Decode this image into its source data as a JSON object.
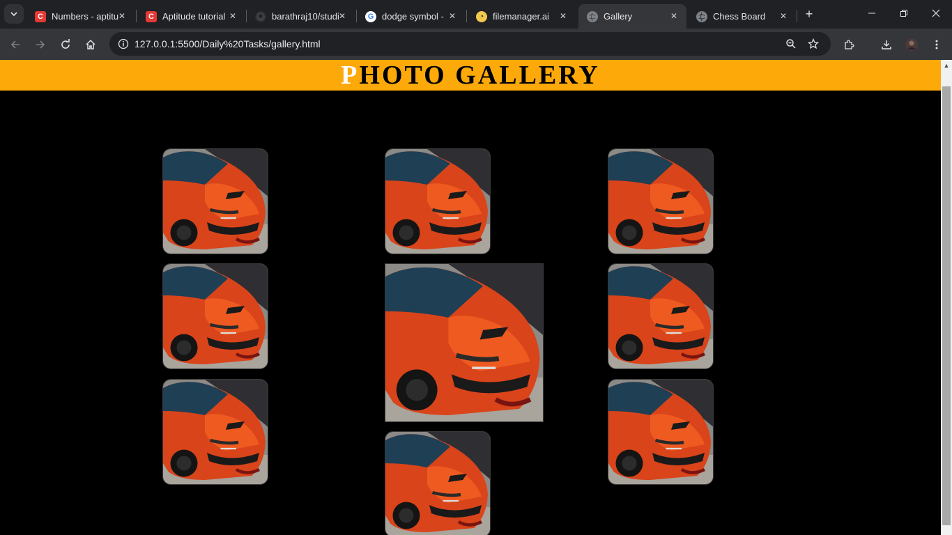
{
  "browser": {
    "tabs": [
      {
        "title": "Numbers - aptitude",
        "favicon": "c-logo-icon",
        "color": "#e53935"
      },
      {
        "title": "Aptitude tutorial",
        "favicon": "c-logo-icon",
        "color": "#e53935"
      },
      {
        "title": "barathraj10/studi",
        "favicon": "github-icon",
        "color": "#24292f"
      },
      {
        "title": "dodge symbol -",
        "favicon": "google-icon",
        "color": "#ffffff"
      },
      {
        "title": "filemanager.ai",
        "favicon": "filemanager-icon",
        "color": "#f2c94c"
      },
      {
        "title": "Gallery",
        "favicon": "globe-icon",
        "color": "#9aa0a6"
      },
      {
        "title": "Chess Board",
        "favicon": "globe-icon",
        "color": "#9aa0a6"
      }
    ],
    "active_tab_index": 5,
    "url": "127.0.0.1:5500/Daily%20Tasks/gallery.html"
  },
  "page": {
    "header_first_letter": "P",
    "header_rest": "HOTO GALLERY",
    "header_color": "#fea90a",
    "photo_alt": "Orange Dodge Charger",
    "photos": [
      {
        "name": "gallery-photo-1",
        "big": false
      },
      {
        "name": "gallery-photo-2",
        "big": false
      },
      {
        "name": "gallery-photo-3",
        "big": false
      },
      {
        "name": "gallery-photo-4",
        "big": false
      },
      {
        "name": "gallery-photo-5-enlarged",
        "big": true
      },
      {
        "name": "gallery-photo-6",
        "big": false
      },
      {
        "name": "gallery-photo-7",
        "big": false
      },
      {
        "name": "gallery-photo-8",
        "big": false
      },
      {
        "name": "gallery-photo-9",
        "big": false
      }
    ]
  }
}
